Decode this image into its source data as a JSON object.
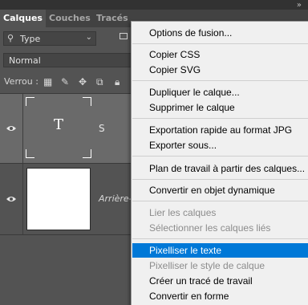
{
  "tabs": [
    {
      "label": "Calques",
      "active": true
    },
    {
      "label": "Couches",
      "active": false
    },
    {
      "label": "Tracés",
      "active": false
    }
  ],
  "filter": {
    "label": "Type"
  },
  "blend": {
    "label": "Normal"
  },
  "lock": {
    "label": "Verrou :"
  },
  "layers": [
    {
      "thumb_glyph": "T",
      "name": "S",
      "selected": true,
      "visible": true
    },
    {
      "name": "Arrière-",
      "visible": true
    }
  ],
  "menu": {
    "items": [
      {
        "label": "Options de fusion...",
        "disabled": false
      },
      {
        "label": "Copier CSS",
        "disabled": false
      },
      {
        "label": "Copier SVG",
        "disabled": false
      },
      {
        "label": "Dupliquer le calque...",
        "disabled": false
      },
      {
        "label": "Supprimer le calque",
        "disabled": false
      },
      {
        "label": "Exportation rapide au format JPG",
        "disabled": false
      },
      {
        "label": "Exporter sous...",
        "disabled": false
      },
      {
        "label": "Plan de travail à partir des calques...",
        "disabled": false
      },
      {
        "label": "Convertir en objet dynamique",
        "disabled": false
      },
      {
        "label": "Lier les calques",
        "disabled": true
      },
      {
        "label": "Sélectionner les calques liés",
        "disabled": true
      },
      {
        "label": "Pixelliser le texte",
        "disabled": false,
        "highlighted": true
      },
      {
        "label": "Pixelliser le style de calque",
        "disabled": true
      },
      {
        "label": "Créer un tracé de travail",
        "disabled": false
      },
      {
        "label": "Convertir en forme",
        "disabled": false
      }
    ]
  },
  "colors": {
    "panel": "#535353",
    "selected_layer": "#6a6a6a",
    "menu_bg": "#f0f0f0",
    "menu_highlight": "#0078d7",
    "disabled_text": "#8c8c8c"
  },
  "icons": {
    "collapse": "double-chevron-right-icon",
    "search": "search-icon",
    "eye": "eye-icon",
    "lock_pixels": "checkerboard-icon",
    "lock_paint": "brush-icon",
    "lock_move": "move-icon",
    "lock_artboard": "artboard-icon",
    "lock_all": "lock-icon"
  }
}
